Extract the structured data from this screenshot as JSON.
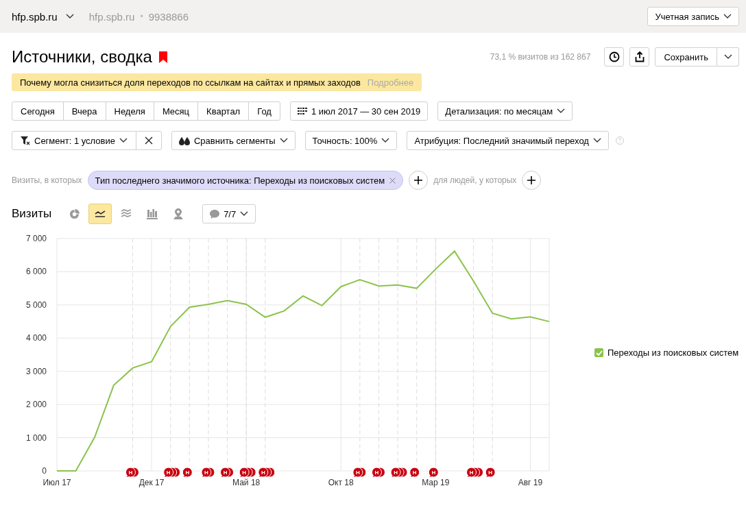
{
  "top_bar": {
    "site": "hfp.spb.ru",
    "counter_site": "hfp.spb.ru",
    "separator": "•",
    "counter_id": "9938866",
    "account_button": "Учетная запись"
  },
  "header": {
    "title": "Источники, сводка",
    "bookmarked": true,
    "sample_info": "73,1 % визитов из 162 867",
    "save_button": "Сохранить"
  },
  "notice": {
    "text": "Почему могла снизиться доля переходов по ссылкам на сайтах и прямых заходов",
    "link": "Подробнее"
  },
  "periods": [
    "Сегодня",
    "Вчера",
    "Неделя",
    "Месяц",
    "Квартал",
    "Год"
  ],
  "date_range": "1 июл 2017 — 30 сен 2019",
  "detail": "Детализация: по месяцам",
  "segment_row": {
    "segment": "Сегмент: 1 условие",
    "compare": "Сравнить сегменты",
    "accuracy": "Точность: 100%",
    "attribution": "Атрибуция: Последний значимый переход"
  },
  "filter": {
    "prefix": "Визиты, в которых",
    "condition": "Тип последнего значимого источника: Переходы из поисковых систем",
    "people": "для людей, у которых"
  },
  "chart_toolbar": {
    "title": "Визиты",
    "chart_types": [
      {
        "kind": "pie",
        "selected": false
      },
      {
        "kind": "line",
        "selected": true
      },
      {
        "kind": "area",
        "selected": false
      },
      {
        "kind": "bar",
        "selected": false
      },
      {
        "kind": "map",
        "selected": false
      }
    ],
    "notes": "7/7"
  },
  "chart": {
    "chart_data": {
      "type": "line",
      "categories": [
        "Июл 17",
        null,
        null,
        null,
        null,
        "Дек 17",
        null,
        null,
        null,
        null,
        "Май 18",
        null,
        null,
        null,
        null,
        "Окт 18",
        null,
        null,
        null,
        null,
        "Мар 19",
        null,
        null,
        null,
        null,
        "Авг 19",
        null
      ],
      "grid": true,
      "series": [
        {
          "name": "Переходы из поисковых систем",
          "color": "#8bc34a",
          "values": [
            0,
            0,
            1020,
            2580,
            3100,
            3290,
            4350,
            4930,
            5020,
            5130,
            5020,
            4630,
            4820,
            5270,
            4980,
            5550,
            5760,
            5570,
            5600,
            5500,
            6080,
            6620,
            5720,
            4750,
            4580,
            4640,
            4500
          ]
        }
      ],
      "ylim": [
        0,
        7000
      ],
      "yticks": [
        {
          "value": 0,
          "label": "0"
        },
        {
          "value": 1000,
          "label": "1 000"
        },
        {
          "value": 2000,
          "label": "2 000"
        },
        {
          "value": 3000,
          "label": "3 000"
        },
        {
          "value": 4000,
          "label": "4 000"
        },
        {
          "value": 5000,
          "label": "5 000"
        },
        {
          "value": 6000,
          "label": "6 000"
        },
        {
          "value": 7000,
          "label": "7 000"
        }
      ]
    },
    "note_markers": [
      {
        "kind": "none"
      },
      {
        "kind": "none"
      },
      {
        "kind": "none"
      },
      {
        "kind": "none"
      },
      {
        "label": "Н",
        "kind": "double"
      },
      {
        "kind": "none"
      },
      {
        "label": "Н",
        "kind": "triple"
      },
      {
        "label": "Н",
        "kind": "single"
      },
      {
        "label": "Н",
        "kind": "double"
      },
      {
        "label": "Н",
        "kind": "double"
      },
      {
        "label": "Н",
        "kind": "triple"
      },
      {
        "label": "Н",
        "kind": "triple"
      },
      {
        "kind": "none"
      },
      {
        "kind": "none"
      },
      {
        "kind": "none"
      },
      {
        "kind": "none"
      },
      {
        "label": "Н",
        "kind": "double"
      },
      {
        "label": "Н",
        "kind": "double"
      },
      {
        "label": "Н",
        "kind": "triple"
      },
      {
        "label": "Н",
        "kind": "single"
      },
      {
        "label": "Н",
        "kind": "single"
      },
      {
        "kind": "none"
      },
      {
        "label": "Н",
        "kind": "triple"
      },
      {
        "label": "Н",
        "kind": "single"
      },
      {
        "kind": "none"
      },
      {
        "kind": "none"
      },
      {
        "kind": "none"
      }
    ],
    "legend": [
      {
        "checked": true
      }
    ]
  }
}
